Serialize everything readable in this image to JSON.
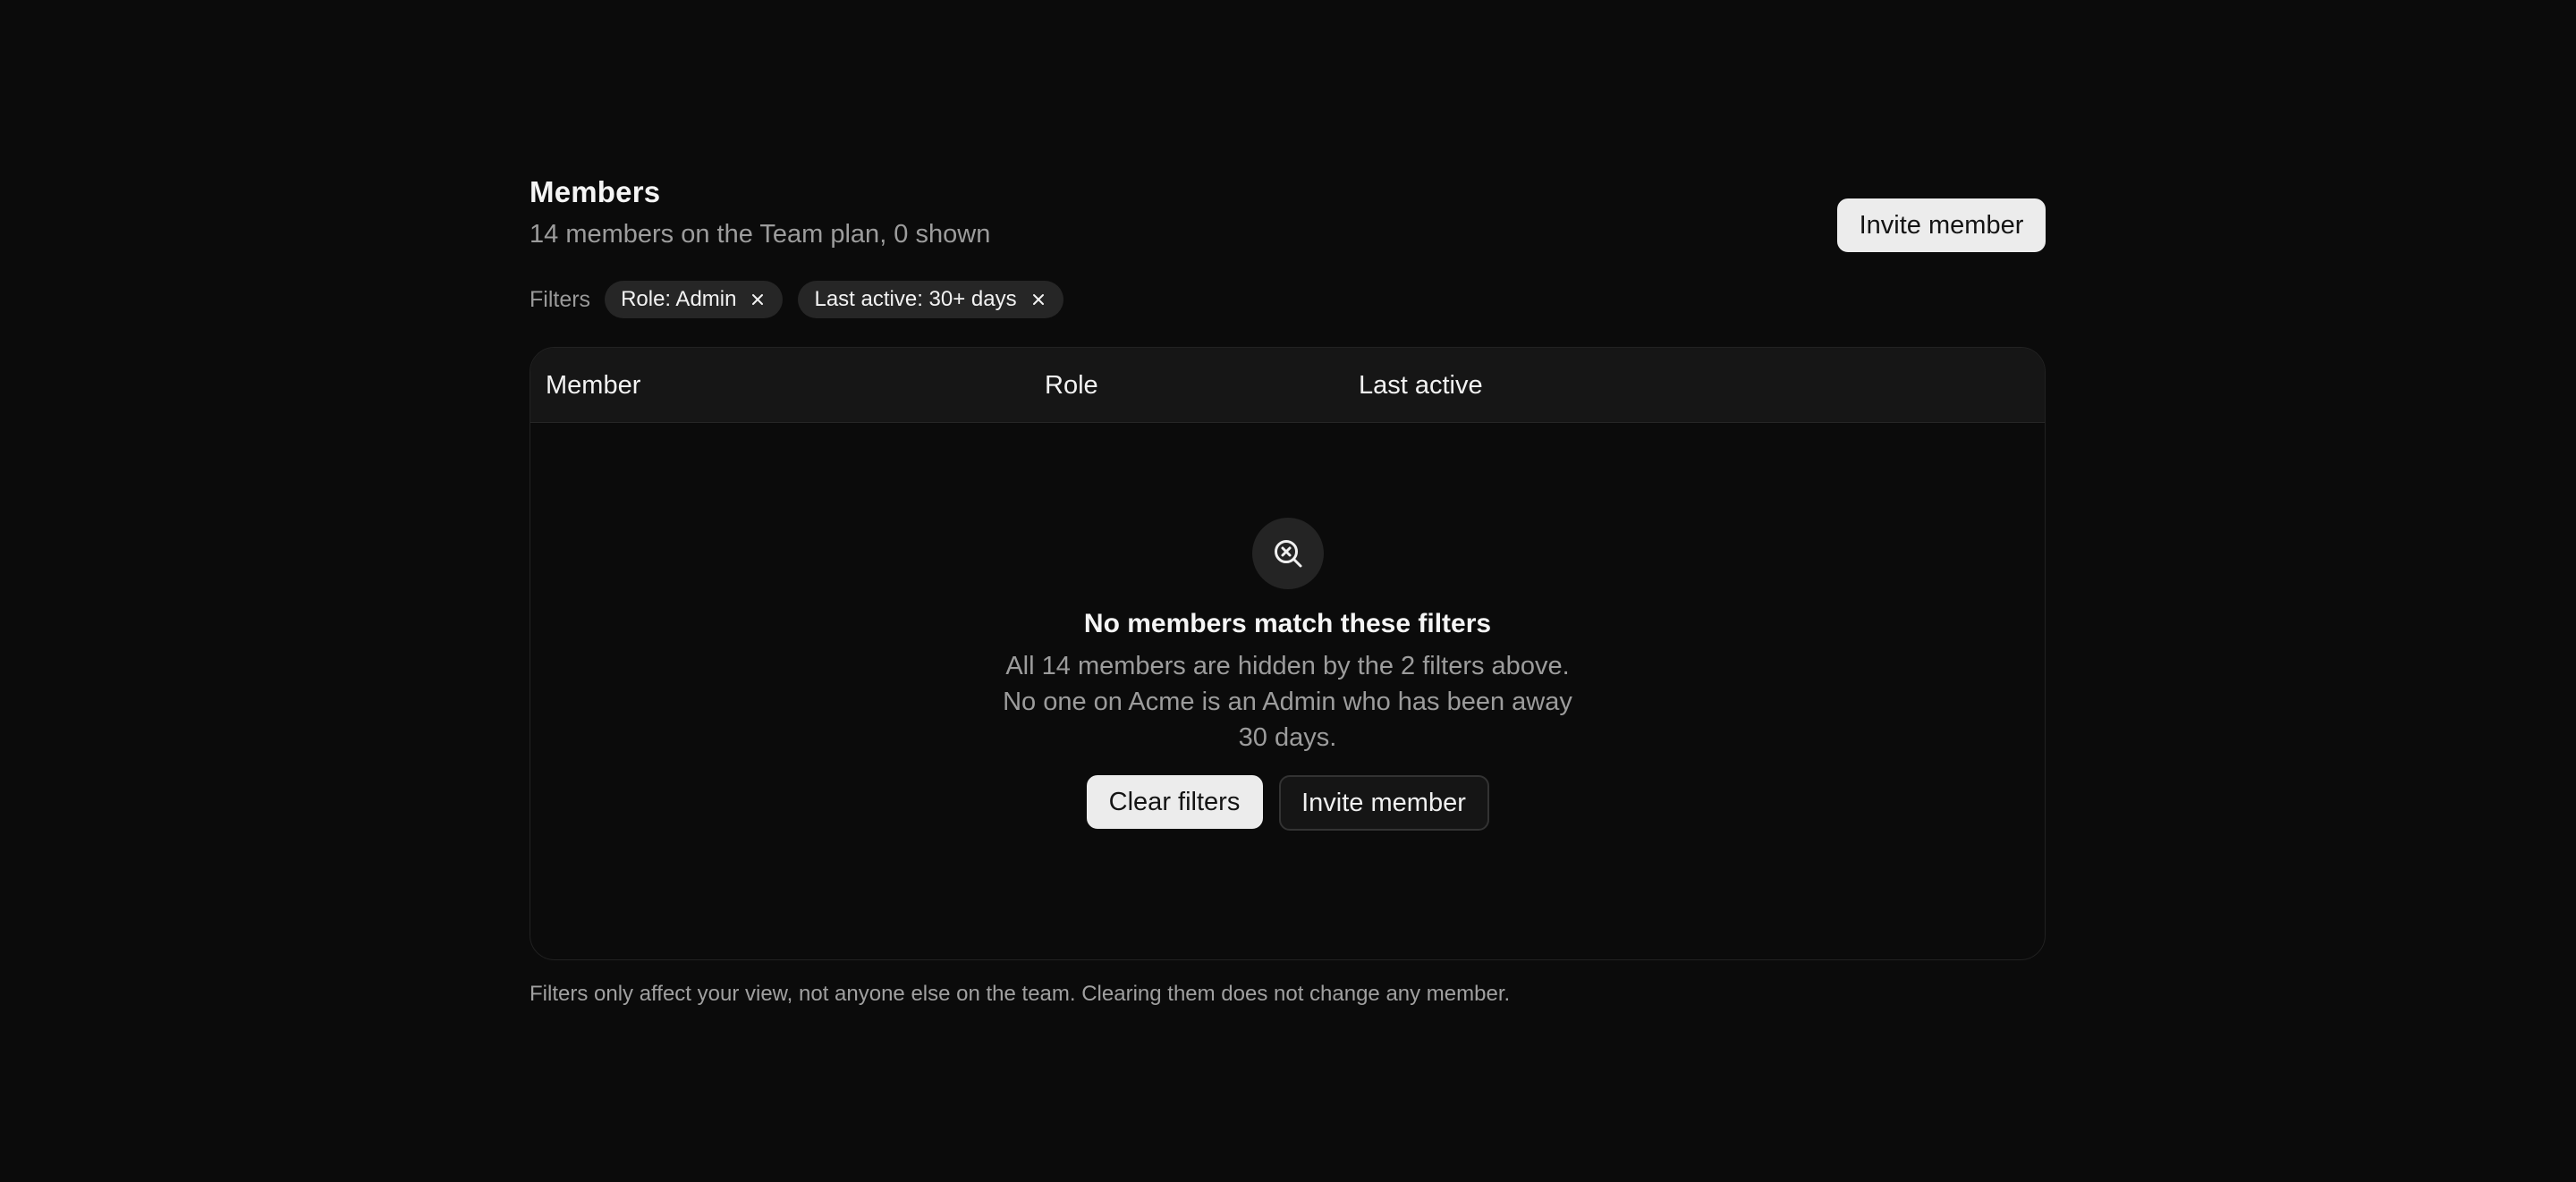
{
  "header": {
    "title": "Members",
    "subtitle": "14 members on the Team plan, 0 shown",
    "invite_label": "Invite member"
  },
  "filters": {
    "label": "Filters",
    "chips": [
      {
        "label": "Role: Admin",
        "remove_icon": "close-icon"
      },
      {
        "label": "Last active: 30+ days",
        "remove_icon": "close-icon"
      }
    ]
  },
  "table": {
    "columns": [
      "Member",
      "Role",
      "Last active"
    ],
    "rows": []
  },
  "empty_state": {
    "icon": "search-x-icon",
    "title": "No members match these filters",
    "description": "All 14 members are hidden by the 2 filters above. No one on Acme is an Admin who has been away 30 days.",
    "clear_label": "Clear filters",
    "invite_label": "Invite member"
  },
  "footer_note": "Filters only affect your view, not anyone else on the team. Clearing them does not change any member.",
  "colors": {
    "background": "#0b0b0b",
    "surface": "#161616",
    "chip": "#262626",
    "primary_button": "#ececec",
    "muted_text": "#9c9c9c"
  }
}
